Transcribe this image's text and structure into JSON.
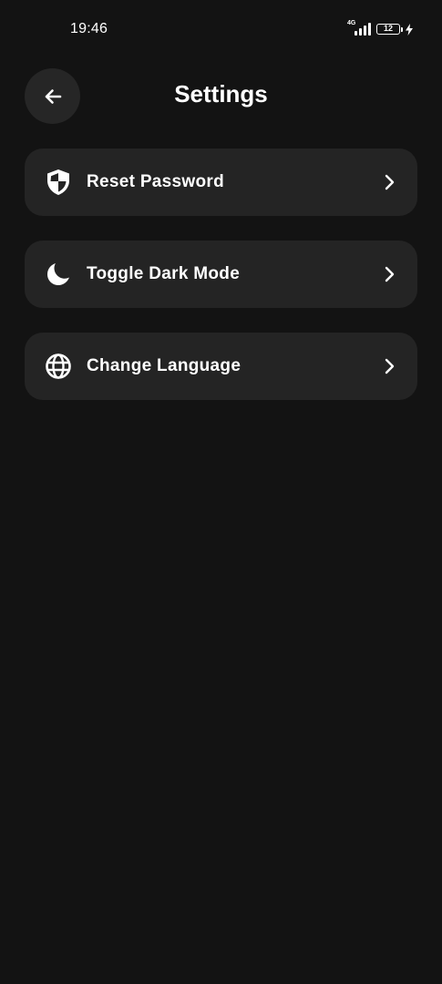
{
  "status_bar": {
    "time": "19:46",
    "network": "4G",
    "battery_level": "12",
    "charging": true
  },
  "header": {
    "title": "Settings",
    "back_icon": "arrow-left-icon"
  },
  "menu": {
    "items": [
      {
        "label": "Reset Password",
        "icon": "shield-icon",
        "chevron": "chevron-right-icon"
      },
      {
        "label": "Toggle Dark Mode",
        "icon": "moon-icon",
        "chevron": "chevron-right-icon"
      },
      {
        "label": "Change Language",
        "icon": "globe-icon",
        "chevron": "chevron-right-icon"
      }
    ]
  },
  "colors": {
    "background": "#131313",
    "card": "#242424",
    "back_button": "#262626",
    "text": "#ffffff"
  }
}
